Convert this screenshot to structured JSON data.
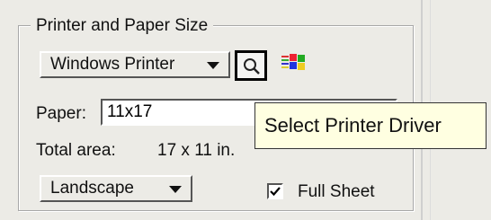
{
  "group": {
    "title": "Printer and Paper Size"
  },
  "printer": {
    "selected": "Windows Printer"
  },
  "icons": {
    "search": "magnifier-icon",
    "windows": "windows-logo-icon"
  },
  "paper": {
    "label": "Paper:",
    "value": "11x17"
  },
  "total": {
    "label": "Total area:",
    "value": "17 x 11 in."
  },
  "orientation": {
    "selected": "Landscape"
  },
  "full_sheet": {
    "label": "Full Sheet",
    "checked": true
  },
  "tooltip": {
    "text": "Select Printer Driver"
  }
}
